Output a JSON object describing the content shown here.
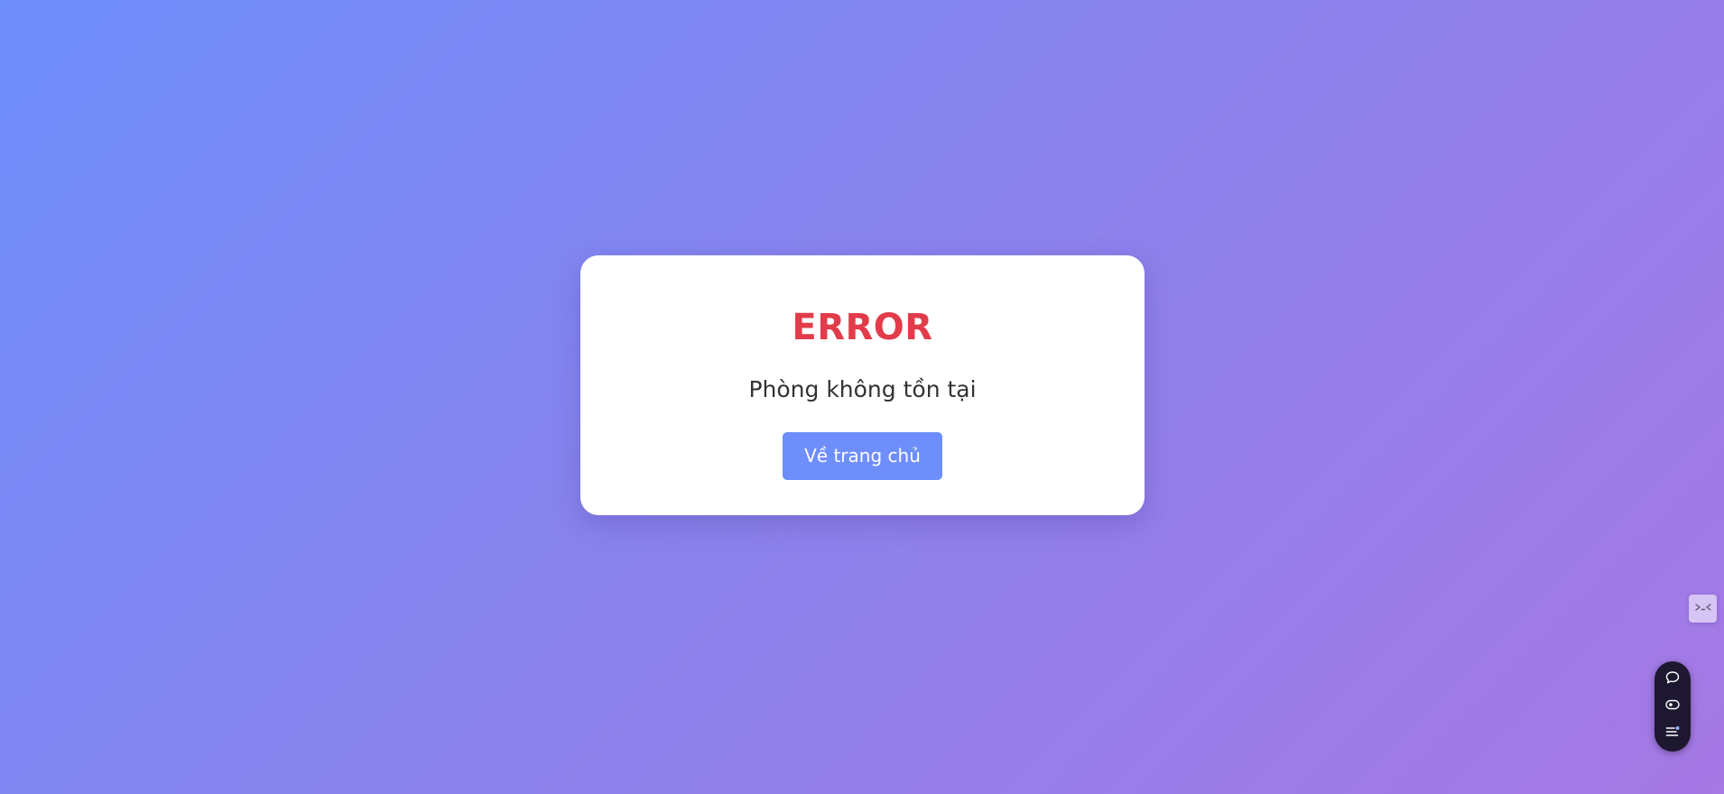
{
  "error_card": {
    "title": "ERROR",
    "message": "Phòng không tồn tại",
    "home_button_label": "Về trang chủ"
  },
  "colors": {
    "background_start": "#6e8efb",
    "background_end": "#a578e4",
    "error_title": "#e23c4b",
    "button": "#6e8efb"
  },
  "side_widgets": {
    "side_tab_icon": "face-icon",
    "toolbar_icons": [
      "chat-icon",
      "eye-icon",
      "list-icon"
    ]
  }
}
